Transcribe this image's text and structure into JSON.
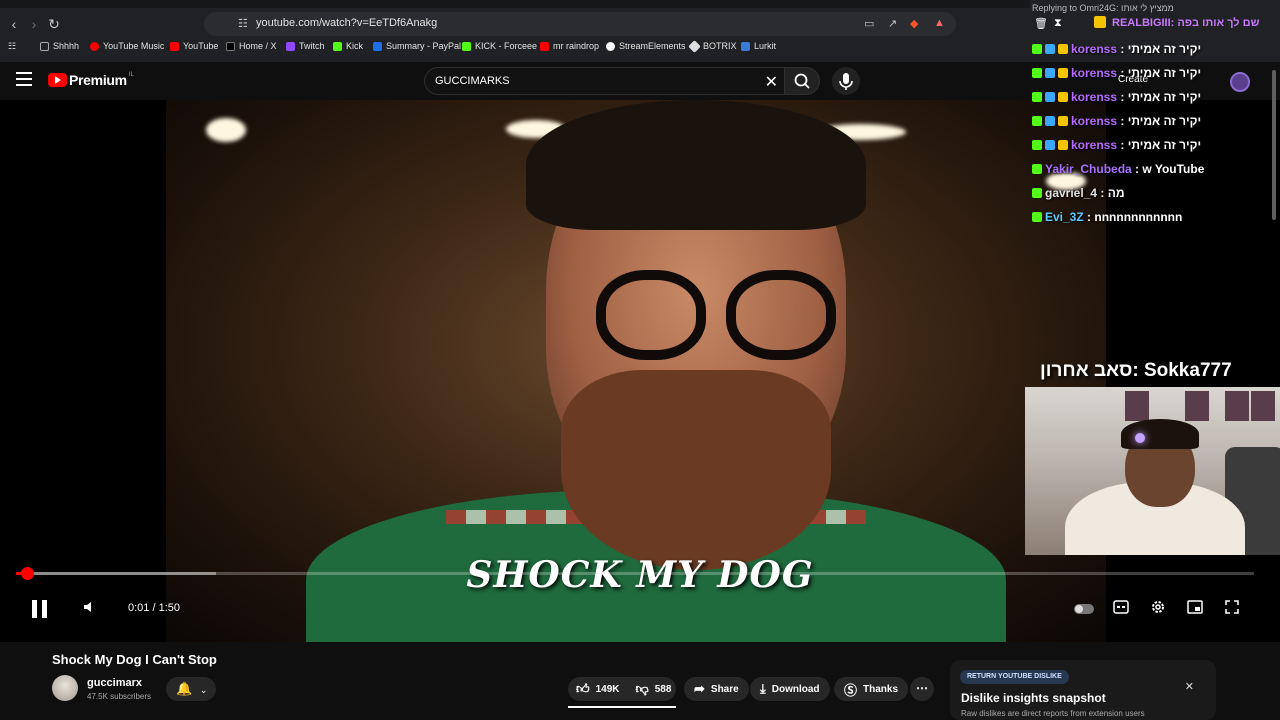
{
  "browser": {
    "url": "youtube.com/watch?v=EeTDf6Anakg",
    "bookmarks": [
      "Shhhh",
      "YouTube Music",
      "YouTube",
      "Home / X",
      "Twitch",
      "Kick",
      "Summary - PayPal",
      "KICK - Forceee",
      "mr raindrop",
      "StreamElements",
      "BOTRIX",
      "Lurkit"
    ]
  },
  "header": {
    "logo_text": "Premium",
    "logo_country": "IL",
    "search_query": "GUCCIMARKS",
    "create_label": "Create"
  },
  "video": {
    "caption": "SHOCK MY DOG",
    "time": "0:01 / 1:50",
    "progress": 0.009
  },
  "stream_overlay": {
    "reply_to": "Replying to Omri24G: ממציץ לי אותו",
    "pinned": "REALBIGIII: שם לך אותו בפה",
    "chat": [
      {
        "user": "korenss",
        "message": "יקיר זה אמיתי",
        "color": "#b56cff"
      },
      {
        "user": "korenss",
        "message": "יקיר זה אמיתי",
        "color": "#b56cff"
      },
      {
        "user": "korenss",
        "message": "יקיר זה אמיתי",
        "color": "#b56cff"
      },
      {
        "user": "korenss",
        "message": "יקיר זה אמיתי",
        "color": "#b56cff"
      },
      {
        "user": "korenss",
        "message": "יקיר זה אמיתי",
        "color": "#b56cff"
      },
      {
        "user": "Yakir_Chubeda",
        "message": "w YouTube",
        "color": "#a970ff"
      },
      {
        "user": "gavriel_4",
        "message": "מה",
        "color": "#e0e0e0"
      },
      {
        "user": "Evi_3Z",
        "message": "nnnnnnnnnnnn",
        "color": "#5cc8ff"
      }
    ],
    "sub_banner": "סאב אחרון: Sokka777"
  },
  "below": {
    "title": "Shock My Dog I Can't Stop",
    "channel": "guccimarx",
    "subscribers": "47.5K subscribers",
    "likes": "149K",
    "dislikes": "588",
    "share": "Share",
    "download": "Download",
    "thanks": "Thanks",
    "dislike_card": {
      "tag": "RETURN YOUTUBE DISLIKE",
      "heading": "Dislike insights snapshot",
      "body": "Raw dislikes are direct reports from extension users"
    }
  },
  "colors": {
    "accent": "#ff0000",
    "page_bg": "#0f0f0f",
    "chrome_bg": "#202124"
  }
}
